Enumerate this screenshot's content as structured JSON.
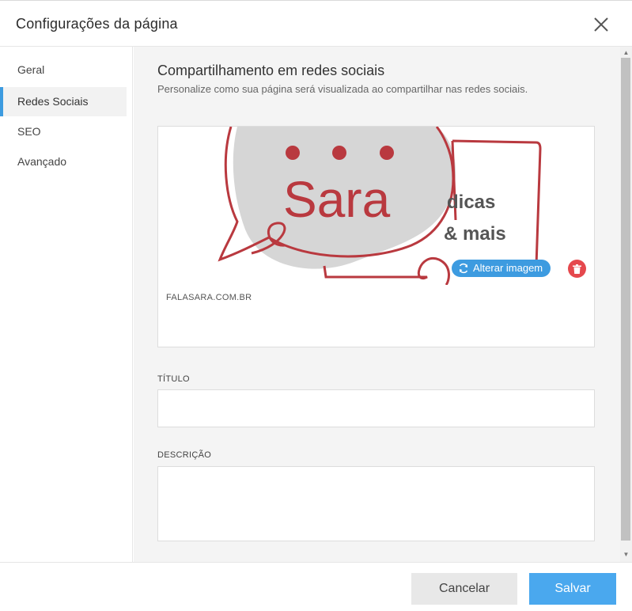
{
  "header": {
    "title": "Configurações da página"
  },
  "sidebar": {
    "items": [
      {
        "label": "Geral"
      },
      {
        "label": "Redes Sociais"
      },
      {
        "label": "SEO"
      },
      {
        "label": "Avançado"
      }
    ]
  },
  "main": {
    "title": "Compartilhamento em redes sociais",
    "description": "Personalize como sua página será visualizada ao compartilhar nas redes sociais.",
    "preview": {
      "image_text_main": "Sara",
      "image_text_line1": "dicas",
      "image_text_line2": "& mais",
      "domain": "FALASARA.COM.BR",
      "alter_label": "Alterar imagem"
    },
    "fields": {
      "title_label": "TÍTULO",
      "title_value": "",
      "description_label": "DESCRIÇÃO",
      "description_value": ""
    }
  },
  "footer": {
    "cancel_label": "Cancelar",
    "save_label": "Salvar"
  },
  "colors": {
    "accent": "#3d9be0",
    "brand_red": "#b9393f",
    "danger": "#e5484d",
    "save": "#4aa8ee"
  }
}
